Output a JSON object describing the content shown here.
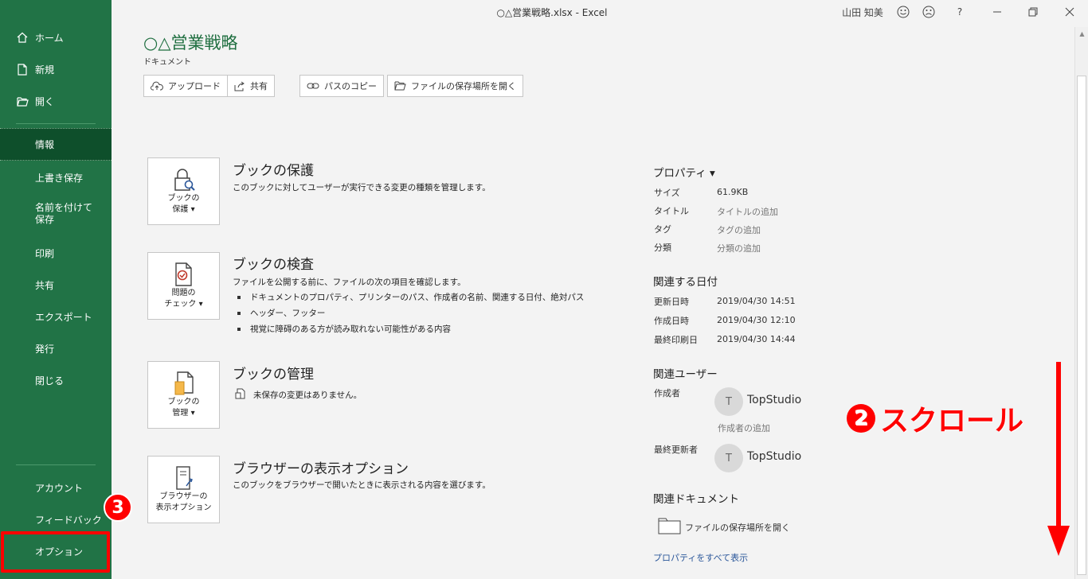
{
  "window": {
    "title": "○△営業戦略.xlsx  -  Excel",
    "user": "山田 知美",
    "help": "?"
  },
  "sidebar": {
    "top_items": [
      {
        "label": "ホーム",
        "icon": "home-icon"
      },
      {
        "label": "新規",
        "icon": "new-document-icon"
      },
      {
        "label": "開く",
        "icon": "open-folder-icon"
      }
    ],
    "items": [
      "情報",
      "上書き保存",
      "名前を付けて保存",
      "印刷",
      "共有",
      "エクスポート",
      "発行",
      "閉じる"
    ],
    "bottom_items": [
      "アカウント",
      "フィードバック",
      "オプション"
    ],
    "active": "情報"
  },
  "header": {
    "title": "○△営業戦略",
    "location": "ドキュメント",
    "buttons": [
      {
        "label": "アップロード",
        "icon": "upload-cloud-icon"
      },
      {
        "label": "共有",
        "icon": "share-icon"
      },
      {
        "label": "パスのコピー",
        "icon": "link-icon"
      },
      {
        "label": "ファイルの保存場所を開く",
        "icon": "folder-icon"
      }
    ]
  },
  "sections": {
    "protect": {
      "button": "ブックの\n保護 ▾",
      "title": "ブックの保護",
      "desc": "このブックに対してユーザーが実行できる変更の種類を管理します。"
    },
    "inspect": {
      "button": "問題の\nチェック ▾",
      "title": "ブックの検査",
      "desc": "ファイルを公開する前に、ファイルの次の項目を確認します。",
      "bullets": [
        "ドキュメントのプロパティ、プリンターのパス、作成者の名前、関連する日付、絶対パス",
        "ヘッダー、フッター",
        "視覚に障碍のある方が読み取れない可能性がある内容"
      ]
    },
    "manage": {
      "button": "ブックの\n管理 ▾",
      "title": "ブックの管理",
      "desc": "未保存の変更はありません。"
    },
    "browser": {
      "button": "ブラウザーの\n表示オプション",
      "title": "ブラウザーの表示オプション",
      "desc": "このブックをブラウザーで開いたときに表示される内容を選びます。"
    }
  },
  "properties": {
    "heading": "プロパティ ▾",
    "rows": [
      {
        "key": "サイズ",
        "value": "61.9KB"
      },
      {
        "key": "タイトル",
        "value": "タイトルの追加"
      },
      {
        "key": "タグ",
        "value": "タグの追加"
      },
      {
        "key": "分類",
        "value": "分類の追加"
      }
    ],
    "dates_heading": "関連する日付",
    "dates": [
      {
        "key": "更新日時",
        "value": "2019/04/30 14:51"
      },
      {
        "key": "作成日時",
        "value": "2019/04/30 12:10"
      },
      {
        "key": "最終印刷日",
        "value": "2019/04/30 14:44"
      }
    ],
    "users_heading": "関連ユーザー",
    "author_key": "作成者",
    "author_initial": "T",
    "author_name": "TopStudio",
    "add_author": "作成者の追加",
    "modifier_key": "最終更新者",
    "modifier_initial": "T",
    "modifier_name": "TopStudio",
    "docs_heading": "関連ドキュメント",
    "open_location": "ファイルの保存場所を開く",
    "show_all": "プロパティをすべて表示"
  },
  "annotations": {
    "scroll_num": "2",
    "scroll_text": "スクロール",
    "step3": "3"
  },
  "colors": {
    "brand": "#217346",
    "active": "#0e4f2b",
    "annotation": "#ff0000",
    "link": "#2b579a"
  }
}
